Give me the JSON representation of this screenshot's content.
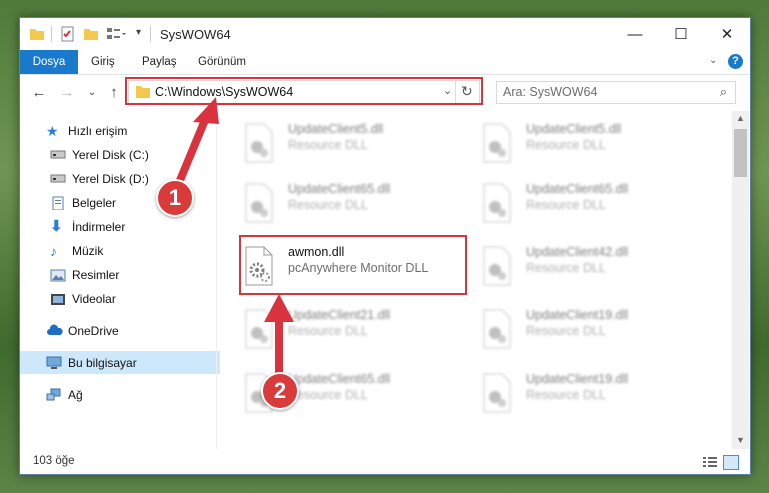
{
  "window": {
    "title": "SysWOW64",
    "minimize": "—",
    "maximize": "☐",
    "close": "✕"
  },
  "ribbon": {
    "tabs": [
      "Dosya",
      "Giriş",
      "Paylaş",
      "Görünüm"
    ],
    "help": "?"
  },
  "address": {
    "path": "C:\\Windows\\SysWOW64",
    "search_placeholder": "Ara: SysWOW64"
  },
  "nav": {
    "quick_access": "Hızlı erişim",
    "pinned": [
      {
        "label": "Yerel Disk (C:)",
        "icon": "drive-icon"
      },
      {
        "label": "Yerel Disk (D:)",
        "icon": "drive-icon"
      },
      {
        "label": "Belgeler",
        "icon": "documents-icon"
      },
      {
        "label": "İndirmeler",
        "icon": "downloads-icon"
      },
      {
        "label": "Müzik",
        "icon": "music-icon"
      },
      {
        "label": "Resimler",
        "icon": "pictures-icon"
      },
      {
        "label": "Videolar",
        "icon": "videos-icon"
      }
    ],
    "onedrive": "OneDrive",
    "this_pc": "Bu bilgisayar",
    "network": "Ağ"
  },
  "files": {
    "left": [
      {
        "name": "UpdateClient5.dll",
        "type": "Resource DLL"
      },
      {
        "name": "UpdateClient65.dll",
        "type": "Resource DLL"
      },
      {
        "name": "awmon.dll",
        "type": "pcAnywhere Monitor DLL"
      },
      {
        "name": "UpdateClient21.dll",
        "type": "Resource DLL"
      },
      {
        "name": "UpdateClient65.dll",
        "type": "Resource DLL"
      }
    ],
    "right": [
      {
        "name": "UpdateClient5.dll",
        "type": "Resource DLL"
      },
      {
        "name": "UpdateClient65.dll",
        "type": "Resource DLL"
      },
      {
        "name": "UpdateClient42.dll",
        "type": "Resource DLL"
      },
      {
        "name": "UpdateClient19.dll",
        "type": "Resource DLL"
      },
      {
        "name": "UpdateClient19.dll",
        "type": "Resource DLL"
      }
    ]
  },
  "status": {
    "count": "103 öğe"
  },
  "annotations": {
    "step1": "1",
    "step2": "2",
    "color": "#d9333f"
  }
}
